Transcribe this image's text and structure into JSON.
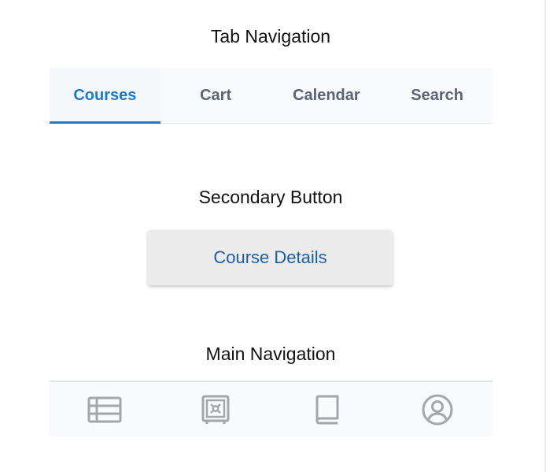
{
  "sections": {
    "tab_navigation_title": "Tab Navigation",
    "secondary_button_title": "Secondary Button",
    "main_navigation_title": "Main Navigation"
  },
  "tabs": [
    {
      "label": "Courses",
      "active": true
    },
    {
      "label": "Cart",
      "active": false
    },
    {
      "label": "Calendar",
      "active": false
    },
    {
      "label": "Search",
      "active": false
    }
  ],
  "secondary_button": {
    "label": "Course Details"
  },
  "main_nav": {
    "items": [
      {
        "icon": "table-list-icon"
      },
      {
        "icon": "safe-icon"
      },
      {
        "icon": "book-icon"
      },
      {
        "icon": "user-circle-icon"
      }
    ]
  },
  "colors": {
    "accent": "#1e79c8",
    "button_text": "#1a5fa6",
    "inactive_tab": "#5b6472",
    "icon_gray": "#a3a7ab"
  }
}
